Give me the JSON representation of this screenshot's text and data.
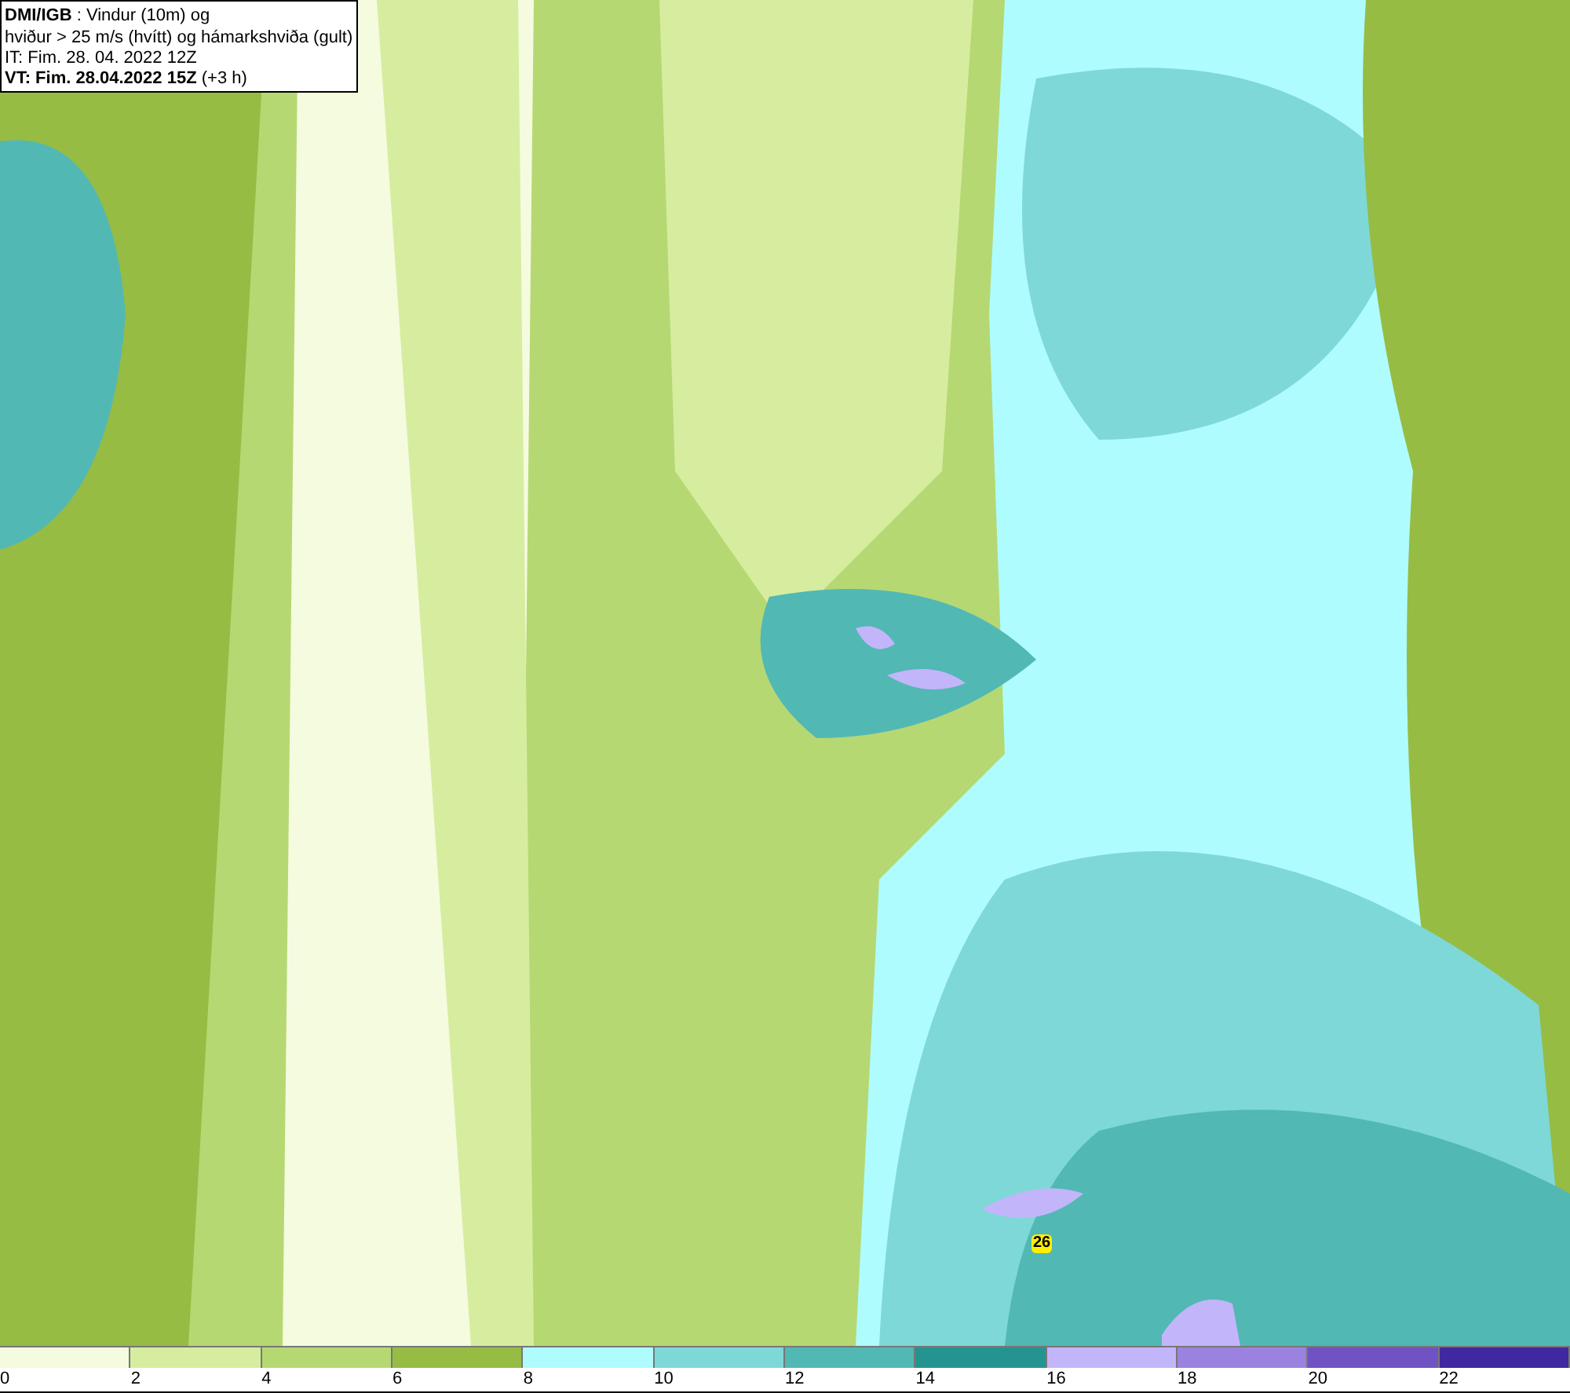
{
  "title_box": {
    "lines": [
      "**DMI/IGB** : Vindur (10m) og",
      "hviður > 25 m/s (hvítt) og hámarkshviða (gult)",
      "IT: Fim. 28. 04. 2022 12Z",
      "**VT: Fim. 28.04.2022 15Z** (+3 h)"
    ]
  },
  "map": {
    "max_gust_label": "26"
  },
  "legend": [
    {
      "label": "0",
      "color": "#f5fbdf"
    },
    {
      "label": "2",
      "color": "#d6eda0"
    },
    {
      "label": "4",
      "color": "#b6d873"
    },
    {
      "label": "6",
      "color": "#96bc44"
    },
    {
      "label": "8",
      "color": "#aefcfd"
    },
    {
      "label": "10",
      "color": "#7ed8d8"
    },
    {
      "label": "12",
      "color": "#52b8b4"
    },
    {
      "label": "14",
      "color": "#259490"
    },
    {
      "label": "16",
      "color": "#c3b5fa"
    },
    {
      "label": "18",
      "color": "#9b82e0"
    },
    {
      "label": "20",
      "color": "#7052c3"
    },
    {
      "label": "22",
      "color": "#4028a0"
    }
  ]
}
